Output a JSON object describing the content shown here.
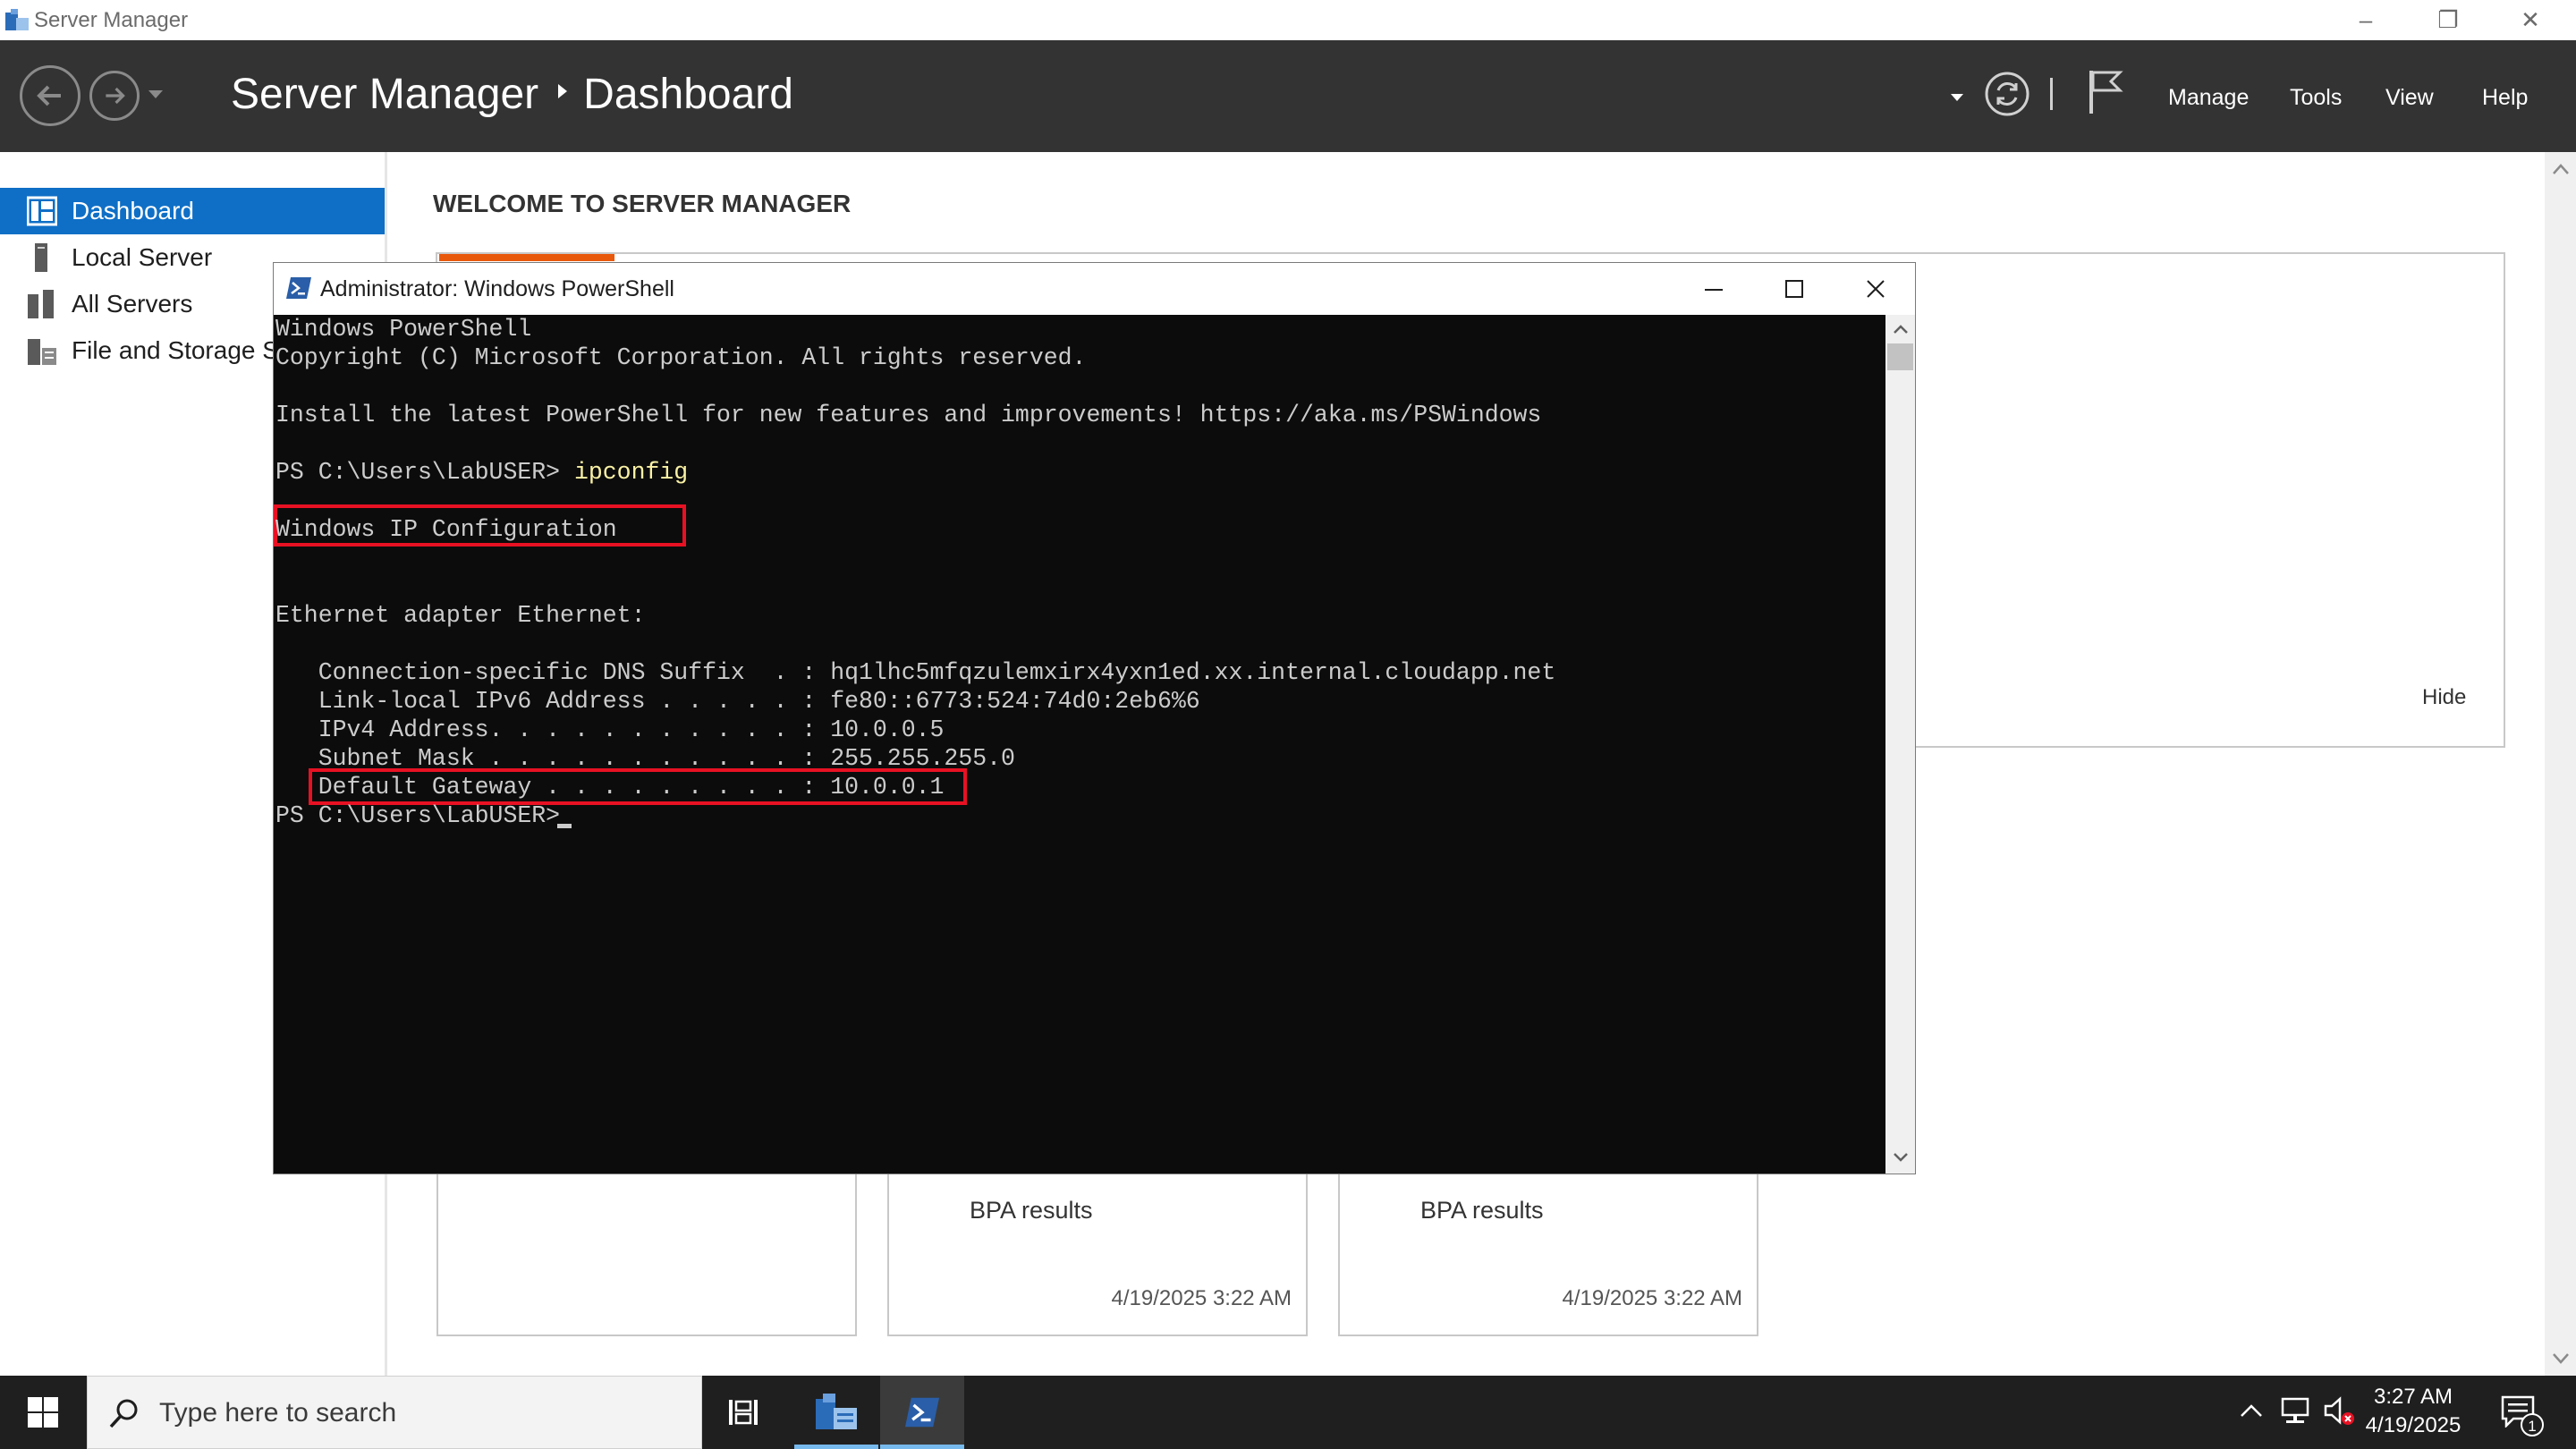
{
  "window": {
    "title": "Server Manager",
    "controls": {
      "minimize": "–",
      "restore": "❐",
      "close": "✕"
    }
  },
  "header": {
    "breadcrumb_root": "Server Manager",
    "breadcrumb_page": "Dashboard",
    "menu": [
      "Manage",
      "Tools",
      "View",
      "Help"
    ]
  },
  "sidebar": {
    "items": [
      {
        "label": "Dashboard",
        "icon": "dashboard-icon",
        "active": true
      },
      {
        "label": "Local Server",
        "icon": "local-server-icon",
        "active": false
      },
      {
        "label": "All Servers",
        "icon": "all-servers-icon",
        "active": false
      },
      {
        "label": "File and Storage Se",
        "icon": "file-storage-icon",
        "active": false
      }
    ]
  },
  "main": {
    "welcome_title": "WELCOME TO SERVER MANAGER",
    "hide_label": "Hide",
    "tiles": [
      {
        "label": "",
        "timestamp": ""
      },
      {
        "label": "BPA results",
        "timestamp": "4/19/2025 3:22 AM"
      },
      {
        "label": "BPA results",
        "timestamp": "4/19/2025 3:22 AM"
      }
    ]
  },
  "powershell": {
    "title": "Administrator: Windows PowerShell",
    "lines": [
      "Windows PowerShell",
      "Copyright (C) Microsoft Corporation. All rights reserved.",
      "",
      "Install the latest PowerShell for new features and improvements! https://aka.ms/PSWindows",
      "",
      "PS C:\\Users\\LabUSER> ",
      "",
      "Windows IP Configuration",
      "",
      "",
      "Ethernet adapter Ethernet:",
      "",
      "   Connection-specific DNS Suffix  . : hq1lhc5mfqzulemxirx4yxn1ed.xx.internal.cloudapp.net",
      "   Link-local IPv6 Address . . . . . : fe80::6773:524:74d0:2eb6%6",
      "   IPv4 Address. . . . . . . . . . . : 10.0.0.5",
      "   Subnet Mask . . . . . . . . . . . : 255.255.255.0",
      "   Default Gateway . . . . . . . . . : 10.0.0.1",
      "PS C:\\Users\\LabUSER> "
    ],
    "command": "ipconfig",
    "highlighted_lines": [
      "prompt-ipconfig",
      "ipv4-address"
    ]
  },
  "taskbar": {
    "search_placeholder": "Type here to search",
    "clock_time": "3:27 AM",
    "clock_date": "4/19/2025",
    "notification_count": "1",
    "apps": [
      "task-view-icon",
      "server-manager-icon",
      "powershell-icon"
    ]
  },
  "colors": {
    "header_bg": "#333333",
    "accent": "#0f6fc6",
    "console_bg": "#0c0c0c",
    "highlight_box": "#e81123",
    "command_text": "#f9f1a5"
  }
}
